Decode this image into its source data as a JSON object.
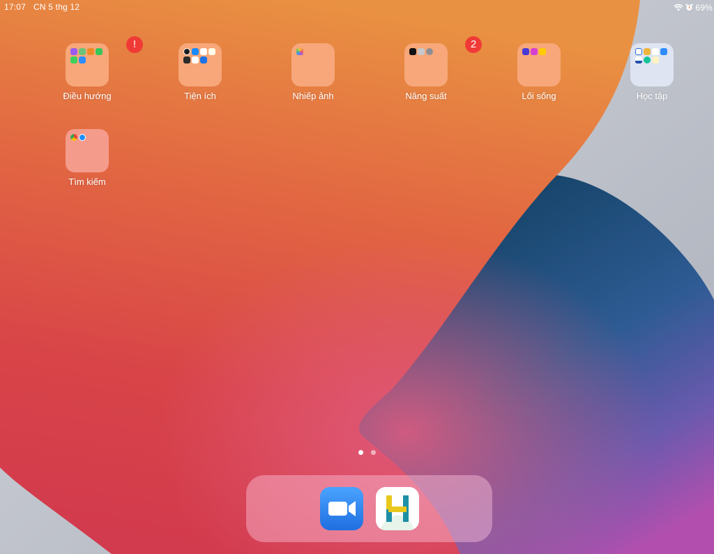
{
  "status_bar": {
    "time": "17:07",
    "date": "CN 5 thg 12",
    "battery": "69%",
    "icons": [
      "wifi-icon",
      "alarm-icon",
      "battery-icon"
    ]
  },
  "folders": [
    {
      "label": "Điều hướng",
      "badge": "!",
      "tile_color": "#f7a779",
      "apps": [
        "podcasts-icon",
        "maps-icon",
        "books-icon",
        "facetime-icon",
        "messages-icon",
        "zoom-mini-icon"
      ]
    },
    {
      "label": "Tiện ích",
      "badge": "",
      "tile_color": "#f7a779",
      "apps": [
        "clock-icon",
        "appstore-icon",
        "files-icon",
        "notes-icon",
        "camera-icon",
        "gmail-icon",
        "meet-icon"
      ]
    },
    {
      "label": "Nhiếp ảnh",
      "badge": "",
      "tile_color": "#f7a779",
      "apps": [
        "photos-icon"
      ]
    },
    {
      "label": "Năng suất",
      "badge": "2",
      "tile_color": "#f7a779",
      "apps": [
        "appletv-icon",
        "contacts-icon",
        "settings-icon"
      ]
    },
    {
      "label": "Lối sống",
      "badge": "",
      "tile_color": "#f7a779",
      "apps": [
        "shortcuts-icon",
        "itunes-icon",
        "tips-icon"
      ]
    },
    {
      "label": "Học tập",
      "badge": "",
      "tile_color": "#e1e8f5",
      "apps": [
        "classroom-icon",
        "duolingo-icon",
        "dictionary-icon",
        "zoom-mini-icon",
        "azota-icon",
        "grammarly-icon",
        "lingo-icon"
      ]
    },
    {
      "label": "Tìm kiếm",
      "badge": "",
      "tile_color": "#f59b8c",
      "apps": [
        "chrome-icon",
        "safari-icon"
      ]
    }
  ],
  "page_dots": {
    "count": 2,
    "active": 0
  },
  "dock": {
    "apps": [
      {
        "name": "zoom-app-icon",
        "color": "#2d8cff"
      },
      {
        "name": "h-app-icon",
        "color": "#ffffff"
      }
    ]
  },
  "colors": {
    "wallpaper_orange": "#e8783f",
    "wallpaper_red": "#d6404a",
    "wallpaper_blue": "#1f4f7a",
    "wallpaper_purple": "#a04db5",
    "wallpaper_gray": "#c2c6ce",
    "badge_red": "#f03a36"
  }
}
